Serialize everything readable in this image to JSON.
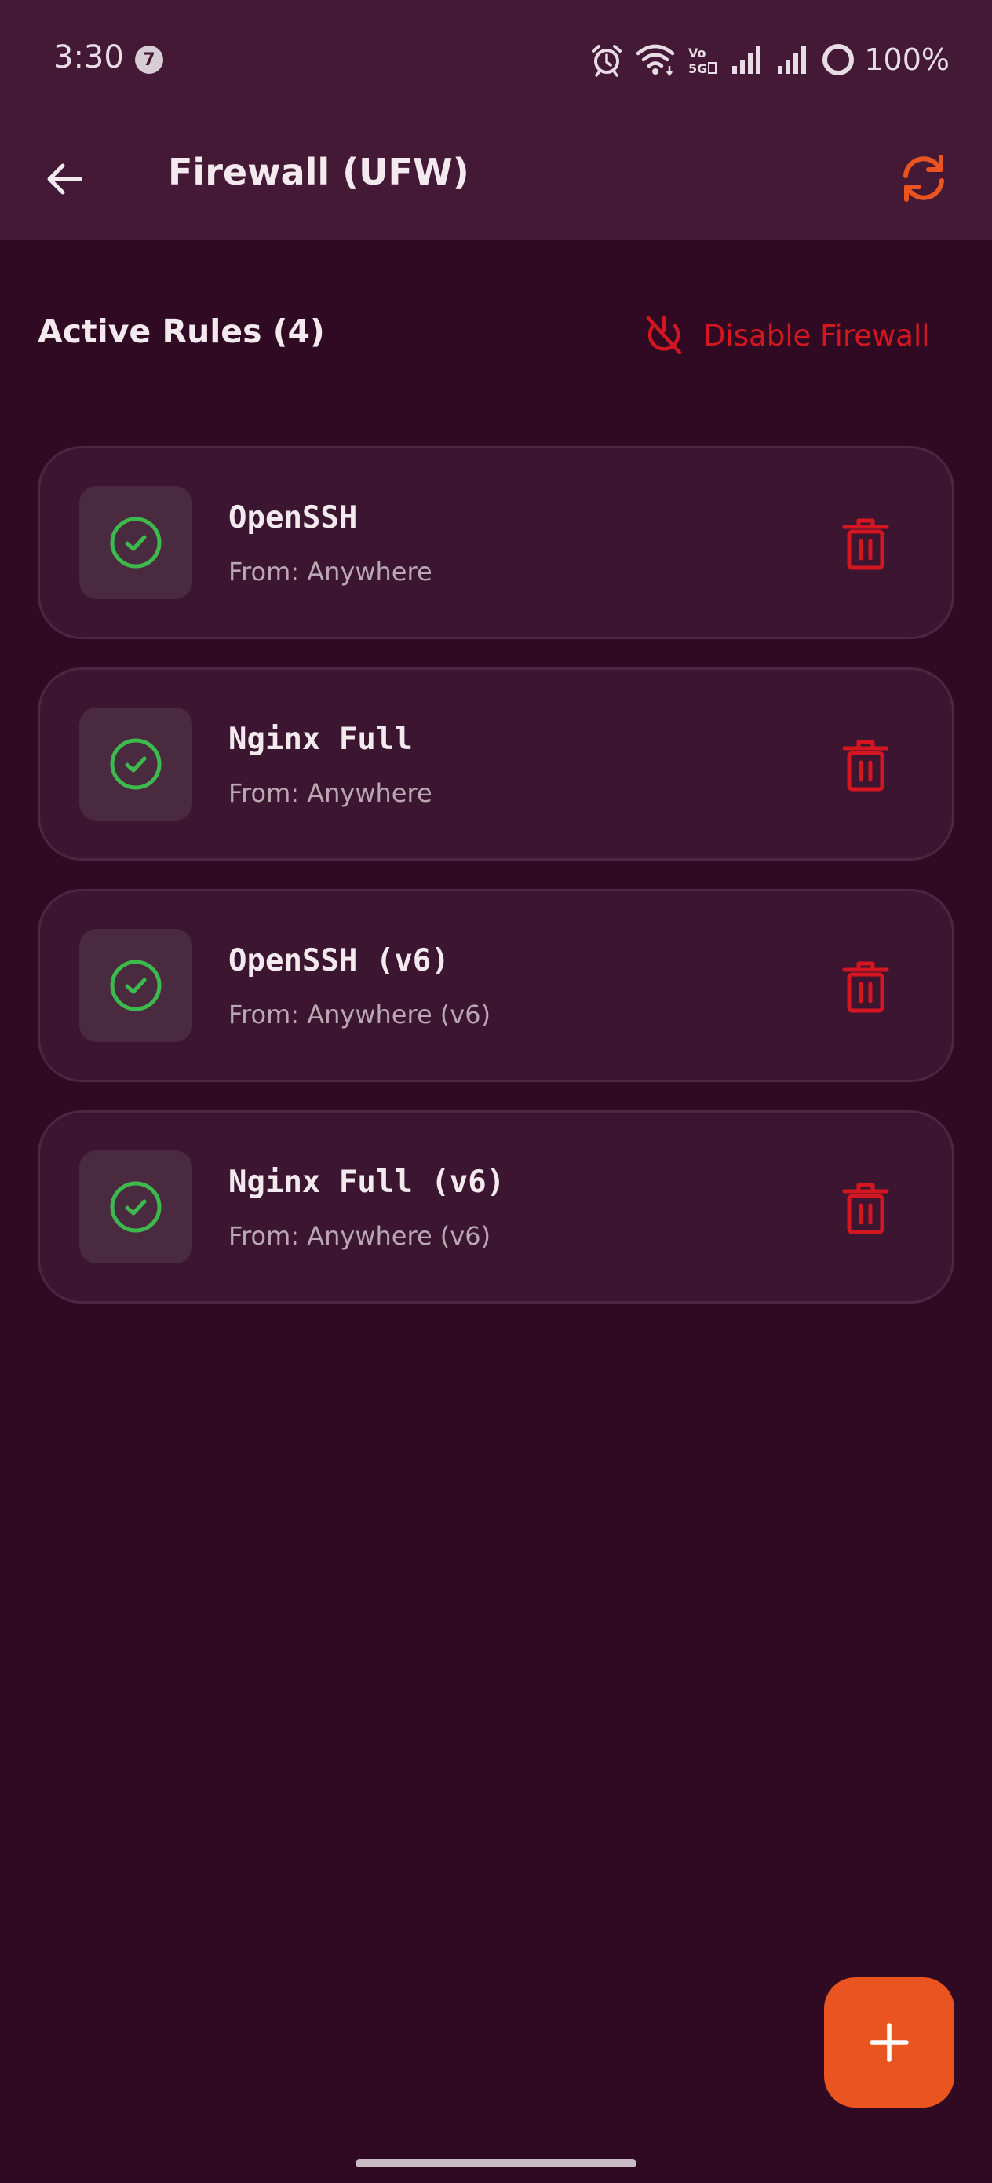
{
  "status_bar": {
    "time": "3:30",
    "notification_count": "7",
    "network_label": "Vo 5G",
    "battery": "100%"
  },
  "app_bar": {
    "title": "Firewall (UFW)"
  },
  "section": {
    "title": "Active Rules (4)",
    "disable_label": "Disable Firewall"
  },
  "rules": [
    {
      "name": "OpenSSH",
      "from": "From: Anywhere",
      "status": "allowed"
    },
    {
      "name": "Nginx Full",
      "from": "From: Anywhere",
      "status": "allowed"
    },
    {
      "name": "OpenSSH (v6)",
      "from": "From: Anywhere (v6)",
      "status": "allowed"
    },
    {
      "name": "Nginx Full (v6)",
      "from": "From: Anywhere (v6)",
      "status": "allowed"
    }
  ],
  "colors": {
    "background": "#2f0a22",
    "top_bar": "#441935",
    "card": "#3c1530",
    "accent": "#e95420",
    "danger": "#d3161f",
    "success": "#3dba4e"
  },
  "icons": {
    "back": "arrow-left-icon",
    "refresh": "refresh-icon",
    "disable": "power-off-icon",
    "rule_status": "check-circle-icon",
    "delete": "trash-icon",
    "add": "plus-icon"
  }
}
